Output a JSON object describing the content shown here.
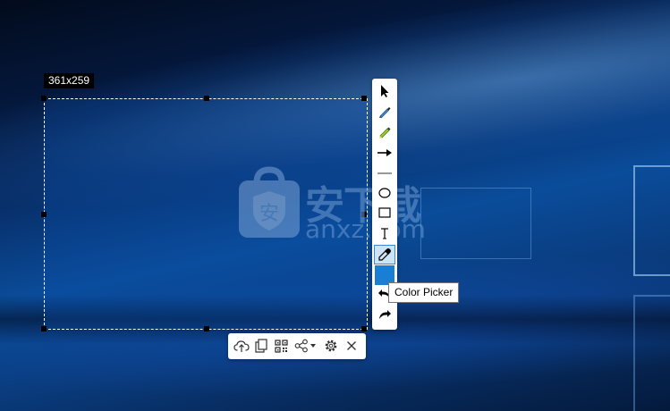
{
  "selection": {
    "size_label": "361x259"
  },
  "watermark": {
    "text_cn": "安下载",
    "text_en": "anxz.com",
    "logo_glyph": "安"
  },
  "side_toolbar": {
    "tools": [
      {
        "icon": "select-arrow-icon"
      },
      {
        "icon": "pen-icon"
      },
      {
        "icon": "highlighter-icon"
      },
      {
        "icon": "arrow-icon"
      },
      {
        "icon": "line-icon"
      },
      {
        "icon": "ellipse-icon"
      },
      {
        "icon": "rectangle-icon"
      },
      {
        "icon": "text-icon"
      },
      {
        "icon": "color-picker-icon",
        "active": true
      },
      {
        "icon": "color-swatch",
        "color": "#1a7fd4"
      },
      {
        "icon": "undo-icon"
      },
      {
        "icon": "redo-icon"
      }
    ],
    "tooltip": "Color Picker"
  },
  "bottom_toolbar": {
    "tools": [
      {
        "icon": "upload-cloud-icon"
      },
      {
        "icon": "copy-icon"
      },
      {
        "icon": "qr-code-icon"
      },
      {
        "icon": "share-icon"
      },
      {
        "icon": "dropdown-caret-icon"
      },
      {
        "icon": "settings-icon"
      },
      {
        "icon": "close-icon"
      }
    ]
  },
  "colors": {
    "selection_border": "#ffffff",
    "toolbar_bg": "#ffffff",
    "active_tool_bg": "#cfe3f6",
    "swatch": "#1a7fd4",
    "pen": "#4a90d9",
    "highlighter": "#9acd32"
  }
}
